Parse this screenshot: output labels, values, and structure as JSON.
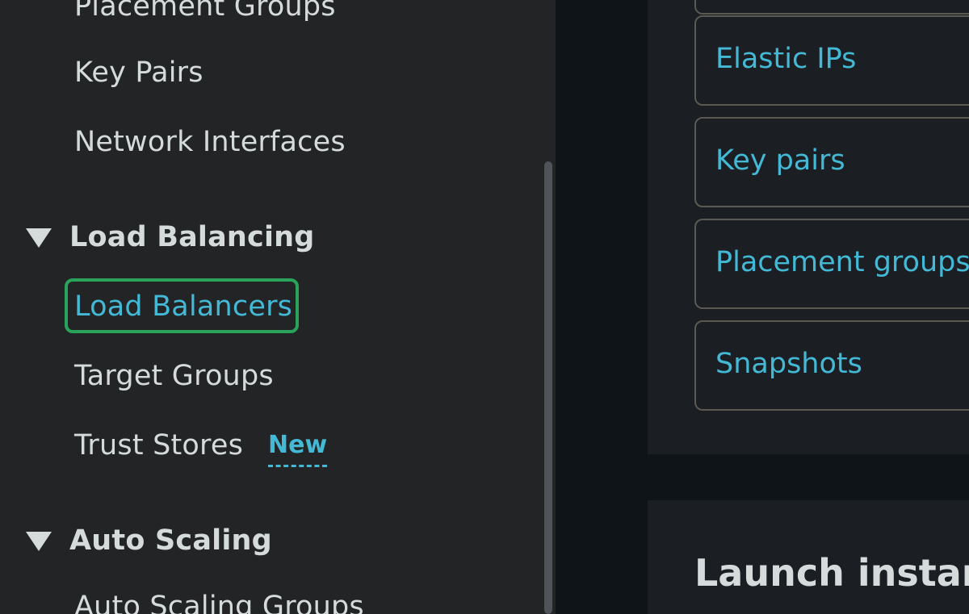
{
  "sidebar": {
    "items_top": [
      {
        "label": "Placement Groups"
      },
      {
        "label": "Key Pairs"
      },
      {
        "label": "Network Interfaces"
      }
    ],
    "sections": [
      {
        "label": "Load Balancing",
        "items": [
          {
            "label": "Load Balancers",
            "active": true
          },
          {
            "label": "Target Groups"
          },
          {
            "label": "Trust Stores",
            "badge": "New"
          }
        ]
      },
      {
        "label": "Auto Scaling",
        "items": [
          {
            "label": "Auto Scaling Groups"
          }
        ]
      }
    ]
  },
  "main": {
    "resources": [
      {
        "label": "Elastic IPs"
      },
      {
        "label": "Key pairs"
      },
      {
        "label": "Placement groups"
      },
      {
        "label": "Snapshots"
      }
    ],
    "launch_title": "Launch instance"
  },
  "colors": {
    "link": "#44b9d6",
    "text": "#d5dbdb",
    "active_outline": "#29a35a",
    "sidebar_bg": "#222426",
    "page_bg": "#0f1419",
    "panel_bg": "#1b1e22"
  }
}
